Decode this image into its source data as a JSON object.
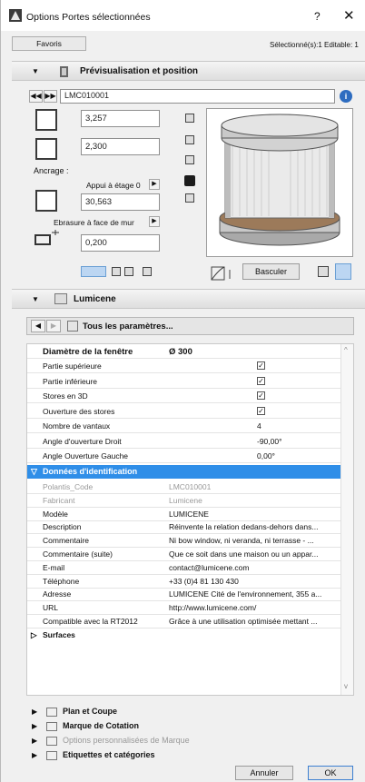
{
  "window": {
    "title": "Options Portes sélectionnées",
    "help": "?",
    "close": "✕",
    "favoris": "Favoris",
    "selection_info": "Sélectionné(s):1 Editable: 1"
  },
  "preview_section": {
    "title": "Prévisualisation et position",
    "element_id": "LMC010001",
    "width_value": "3,257",
    "height_value": "2,300",
    "anchor_label": "Ancrage :",
    "anchor_option": "Appui à étage 0",
    "sill_value": "30,563",
    "reveal_option": "Ebrasure à face de mur",
    "reveal_value": "0,200",
    "flip_button": "Basculer"
  },
  "params_section": {
    "title": "Lumicene",
    "all_params": "Tous les paramètres..."
  },
  "table": {
    "header_key": "Diamètre de la fenêtre",
    "header_value": "Ø 300",
    "rows_a": [
      {
        "k": "Partie supérieure",
        "v": "",
        "check": true
      },
      {
        "k": "Partie inférieure",
        "v": "",
        "check": true
      },
      {
        "k": "Stores en 3D",
        "v": "",
        "check": true
      },
      {
        "k": "Ouverture des stores",
        "v": "",
        "check": true
      },
      {
        "k": "Nombre de vantaux",
        "v": "4",
        "check": false
      },
      {
        "k": "Angle d'ouverture Droit",
        "v": "-90,00°",
        "check": false
      },
      {
        "k": "Angle Ouverture Gauche",
        "v": "0,00°",
        "check": false
      }
    ],
    "group_id": "Données d'identification",
    "rows_b": [
      {
        "k": "Polantis_Code",
        "v": "LMC010001",
        "dim": true
      },
      {
        "k": "Fabricant",
        "v": "Lumicene",
        "dim": true
      },
      {
        "k": "Modèle",
        "v": "LUMICENE",
        "dim": false
      },
      {
        "k": "Description",
        "v": "Réinvente la relation dedans-dehors dans...",
        "dim": false
      },
      {
        "k": "Commentaire",
        "v": "Ni bow window, ni veranda, ni terrasse - ...",
        "dim": false
      },
      {
        "k": "Commentaire (suite)",
        "v": "Que ce soit dans une maison ou un appar...",
        "dim": false
      },
      {
        "k": "E-mail",
        "v": "contact@lumicene.com",
        "dim": false
      },
      {
        "k": "Téléphone",
        "v": "+33 (0)4 81 130 430",
        "dim": false
      },
      {
        "k": "Adresse",
        "v": "LUMICENE Cité de l'environnement, 355 a...",
        "dim": false
      },
      {
        "k": "URL",
        "v": "http://www.lumicene.com/",
        "dim": false
      },
      {
        "k": "Compatible avec la RT2012",
        "v": "Grâce à une utilisation optimisée mettant ...",
        "dim": false
      }
    ],
    "group_surfaces": "Surfaces"
  },
  "bottom_sections": [
    {
      "label": "Plan et Coupe",
      "dim": false
    },
    {
      "label": "Marque de Cotation",
      "dim": false
    },
    {
      "label": "Options personnalisées de Marque",
      "dim": true
    },
    {
      "label": "Etiquettes et catégories",
      "dim": false
    }
  ],
  "footer": {
    "cancel": "Annuler",
    "ok": "OK"
  }
}
